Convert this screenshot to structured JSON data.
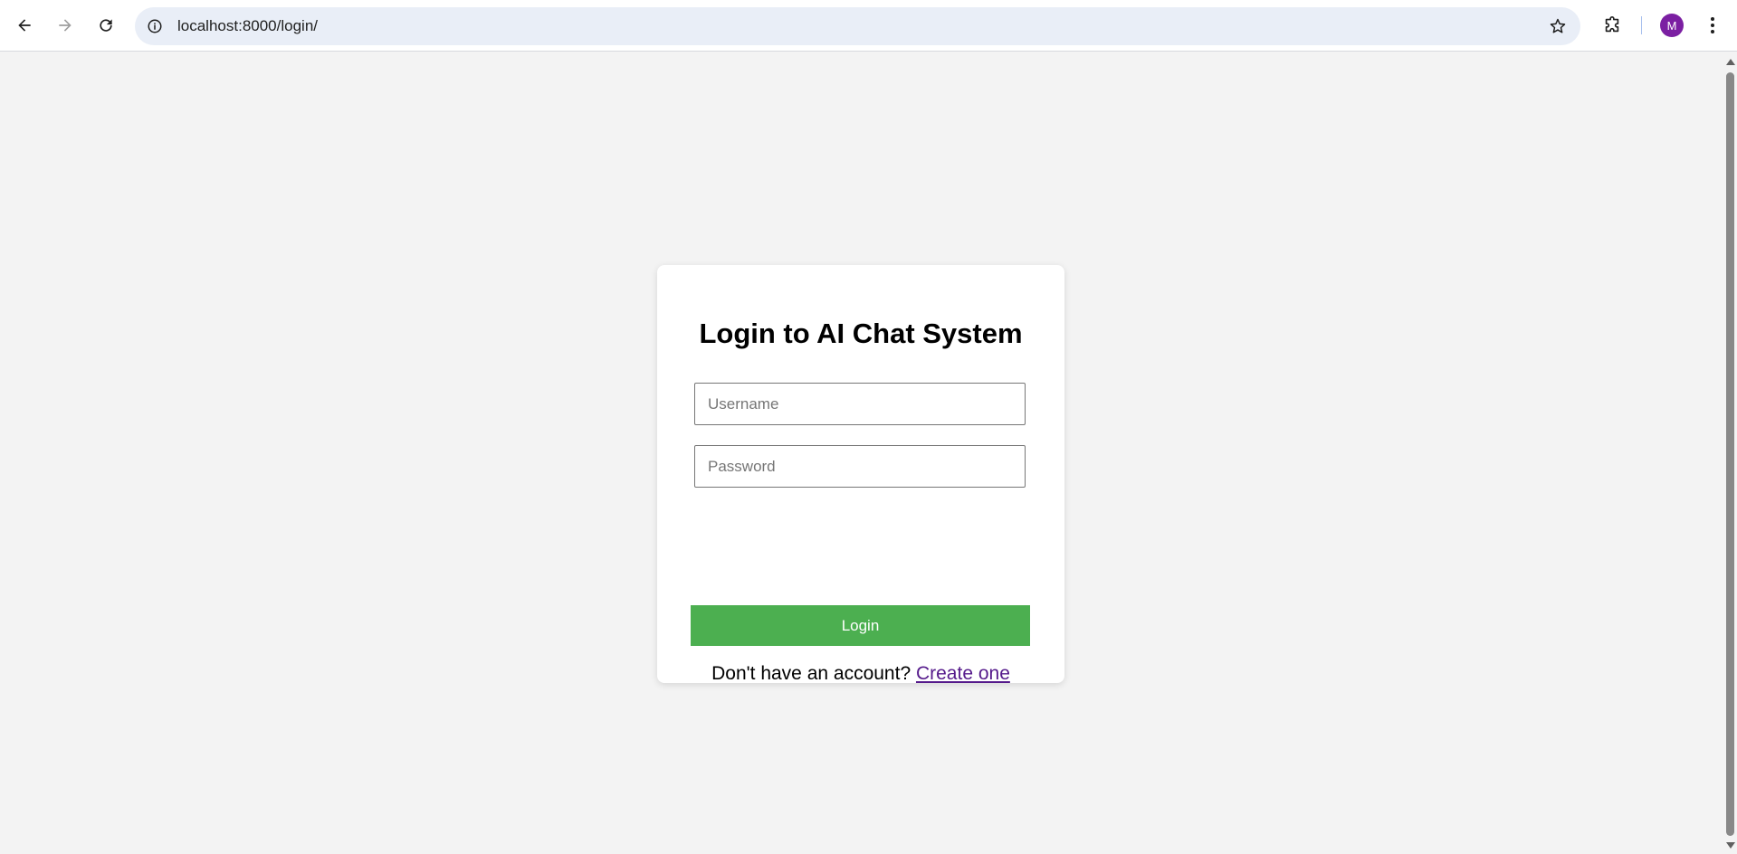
{
  "browser": {
    "url": "localhost:8000/login/",
    "profile_initial": "M",
    "icons": {
      "back": "arrow-left-icon",
      "forward": "arrow-right-icon",
      "reload": "reload-icon",
      "site_info": "info-icon",
      "bookmark": "star-icon",
      "extensions": "puzzle-icon",
      "menu": "more-vert-icon"
    }
  },
  "login": {
    "title": "Login to AI Chat System",
    "username_placeholder": "Username",
    "password_placeholder": "Password",
    "submit_label": "Login",
    "signup_prompt": "Don't have an account?",
    "signup_link": "Create one"
  },
  "colors": {
    "page_background": "#f3f3f3",
    "card_background": "#ffffff",
    "button_green": "#4caf50",
    "link_visited": "#551a8b",
    "avatar_purple": "#7b1fa2"
  }
}
